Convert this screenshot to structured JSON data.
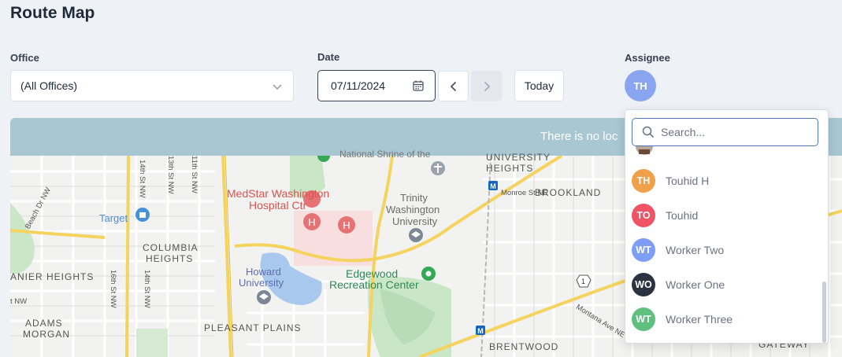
{
  "page": {
    "title": "Route Map"
  },
  "filters": {
    "office_label": "Office",
    "office_value": "(All Offices)",
    "date_label": "Date",
    "date_value": "07/11/2024",
    "today_label": "Today",
    "assignee_label": "Assignee",
    "assignee_initials": "TH"
  },
  "map": {
    "banner_text": "There is no loc",
    "labels": {
      "medstar_1": "MedStar Washington",
      "medstar_2": "Hospital Ctr",
      "trinity_1": "Trinity",
      "trinity_2": "Washington",
      "trinity_3": "University",
      "howard_1": "Howard",
      "howard_2": "University",
      "edgewood_1": "Edgewood",
      "edgewood_2": "Recreation Center",
      "brookland": "BROOKLAND",
      "university_heights_1": "UNIVERSITY",
      "university_heights_2": "HEIGHTS",
      "columbia_heights_1": "COLUMBIA",
      "columbia_heights_2": "HEIGHTS",
      "pleasant_plains": "PLEASANT PLAINS",
      "adams_morgan_1": "ADAMS",
      "adams_morgan_2": "MORGAN",
      "brentwood": "BRENTWOOD",
      "lanier_heights": "ANIER HEIGHTS",
      "target": "Target",
      "national_shrine": "National Shrine of the",
      "monroe": "Monroe St NE",
      "montana": "Montana Ave NE",
      "gateway": "GATEWAY",
      "st14": "14th St NW",
      "st13": "13th St NW",
      "st11": "11th St NW",
      "st16": "16th St NW",
      "st14b": "14th St NW",
      "beach": "Beach Dr NW",
      "nw": "t NW",
      "route1": "1"
    }
  },
  "assignee_dropdown": {
    "search_placeholder": "Search...",
    "users": [
      {
        "initials": "TH",
        "name": "Touhid H",
        "color": "#f0a04b"
      },
      {
        "initials": "TO",
        "name": "Touhid",
        "color": "#ef5466"
      },
      {
        "initials": "WT",
        "name": "Worker Two",
        "color": "#7d9ef2"
      },
      {
        "initials": "WO",
        "name": "Worker One",
        "color": "#2b3240"
      },
      {
        "initials": "WT",
        "name": "Worker Three",
        "color": "#5fbf7f"
      }
    ]
  },
  "colors": {
    "background": "#eef1f6",
    "banner": "#a8c7d3",
    "accent_border": "#4b7ac4"
  },
  "icons": [
    "chevron-down-icon",
    "calendar-icon",
    "chevron-left-icon",
    "chevron-right-icon",
    "search-icon",
    "hospital-icon",
    "park-marker-icon",
    "school-icon",
    "shopping-icon",
    "metro-icon"
  ]
}
